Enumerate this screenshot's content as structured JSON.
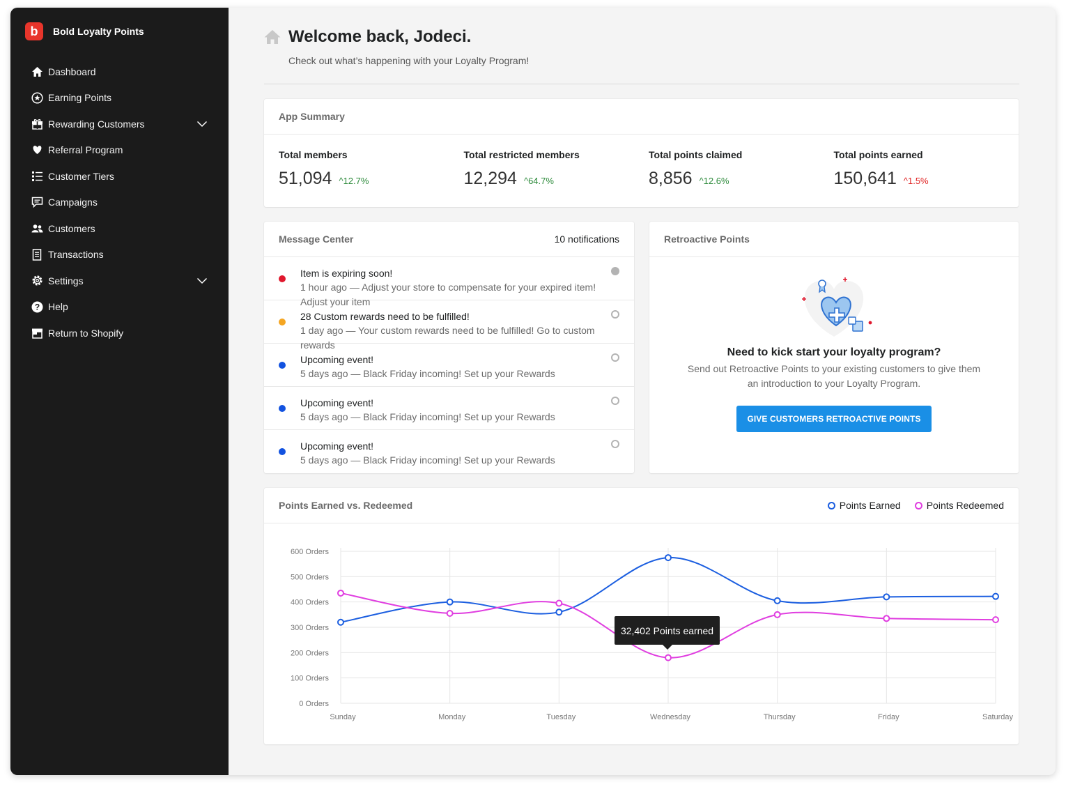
{
  "app": {
    "name": "Bold Loyalty Points",
    "logo_letter": "b",
    "brand_color": "#e8352b"
  },
  "sidebar": {
    "items": [
      {
        "label": "Dashboard",
        "icon": "home-icon"
      },
      {
        "label": "Earning Points",
        "icon": "star-circle-icon"
      },
      {
        "label": "Rewarding Customers",
        "icon": "gift-icon",
        "expandable": true
      },
      {
        "label": "Referral Program",
        "icon": "heart-icon"
      },
      {
        "label": "Customer Tiers",
        "icon": "list-icon"
      },
      {
        "label": "Campaigns",
        "icon": "chat-icon"
      },
      {
        "label": "Customers",
        "icon": "users-icon"
      },
      {
        "label": "Transactions",
        "icon": "receipt-icon"
      },
      {
        "label": "Settings",
        "icon": "gear-icon",
        "expandable": true
      },
      {
        "label": "Help",
        "icon": "help-icon"
      },
      {
        "label": "Return to Shopify",
        "icon": "store-icon"
      }
    ]
  },
  "header": {
    "title": "Welcome back, Jodeci.",
    "subtitle": "Check out what’s happening with your Loyalty Program!"
  },
  "summary": {
    "title": "App Summary",
    "stats": [
      {
        "label": "Total members",
        "value": "51,094",
        "change": "12.7%",
        "trend": "up"
      },
      {
        "label": "Total restricted members",
        "value": "12,294",
        "change": "64.7%",
        "trend": "up"
      },
      {
        "label": "Total points claimed",
        "value": "8,856",
        "change": "12.6%",
        "trend": "up"
      },
      {
        "label": "Total points earned",
        "value": "150,641",
        "change": "1.5%",
        "trend": "up-red"
      }
    ]
  },
  "messages": {
    "title": "Message Center",
    "count": "10 notifications",
    "items": [
      {
        "title": "Item is expiring soon!",
        "desc": "1 hour ago — Adjust your store to compensate for your expired item! Adjust your item",
        "color": "#e0182d",
        "read": true
      },
      {
        "title": "28 Custom rewards need to be fulfilled!",
        "desc": "1 day ago — Your custom rewards need to be fulfilled! Go to custom rewards",
        "color": "#f5a623",
        "read": false
      },
      {
        "title": "Upcoming event!",
        "desc": "5 days ago — Black Friday incoming! Set up your Rewards",
        "color": "#1252e0",
        "read": false
      },
      {
        "title": "Upcoming event!",
        "desc": "5 days ago — Black Friday incoming! Set up your Rewards",
        "color": "#1252e0",
        "read": false
      },
      {
        "title": "Upcoming event!",
        "desc": "5 days ago — Black Friday incoming! Set up your Rewards",
        "color": "#1252e0",
        "read": false
      }
    ]
  },
  "retro": {
    "title": "Retroactive Points",
    "heading": "Need to kick start your loyalty program?",
    "desc_line1": "Send out Retroactive Points to your existing customers to give them",
    "desc_line2": "an introduction to your Loyalty Program.",
    "button": "GIVE CUSTOMERS RETROACTIVE POINTS"
  },
  "chart_data": {
    "type": "line",
    "title": "Points Earned vs. Redeemed",
    "categories": [
      "Sunday",
      "Monday",
      "Tuesday",
      "Wednesday",
      "Thursday",
      "Friday",
      "Saturday"
    ],
    "y_ticks": [
      "0 Orders",
      "100 Orders",
      "200 Orders",
      "300 Orders",
      "400 Orders",
      "500 Orders",
      "600 Orders"
    ],
    "ylim": [
      0,
      600
    ],
    "grid": true,
    "legend_position": "top-right",
    "series": [
      {
        "name": "Points Earned",
        "color": "#1b5ee0",
        "values": [
          320,
          400,
          360,
          575,
          405,
          420,
          422
        ]
      },
      {
        "name": "Points Redeemed",
        "color": "#e03ee0",
        "values": [
          435,
          355,
          395,
          180,
          350,
          335,
          330
        ]
      }
    ],
    "tooltip": "32,402 Points earned"
  }
}
